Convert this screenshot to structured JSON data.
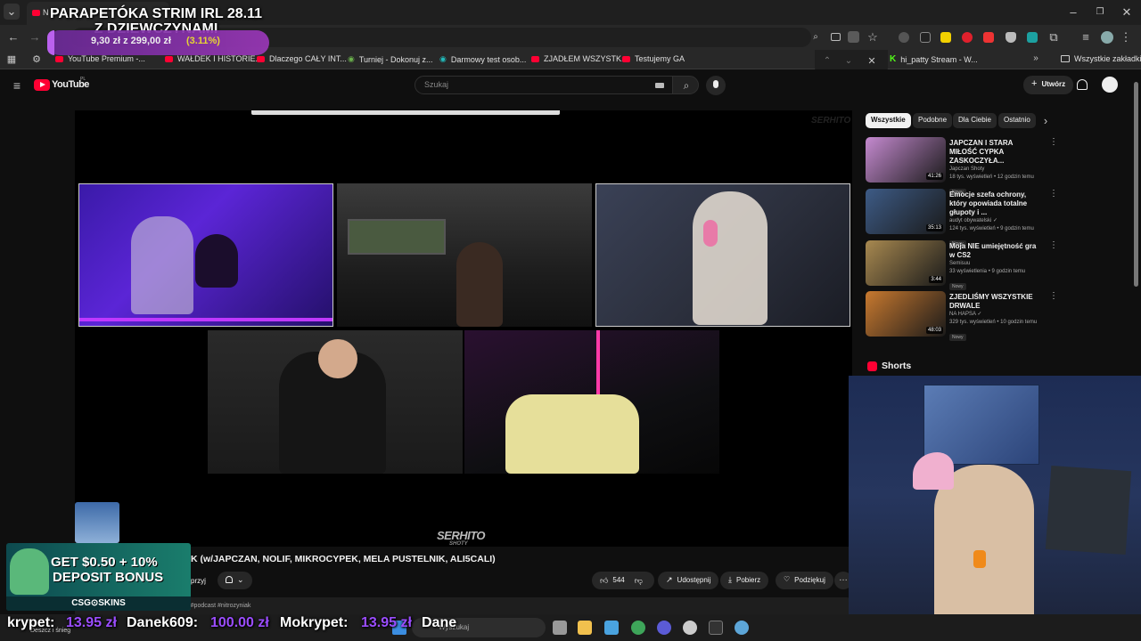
{
  "overlay": {
    "stream_title": "PARAPETÓKA STRIM IRL 28.11 Z DZIEWCZYNAMI",
    "goal_text": "9,30 zł z 299,00 zł",
    "goal_percent": "(3.11%)",
    "goal_progress": 0.0311,
    "ticker": [
      {
        "name": "krypet:",
        "amount": "13.95 zł"
      },
      {
        "name": "Danek609:",
        "amount": "100.00 zł"
      },
      {
        "name": "Mokrypet:",
        "amount": "13.95 zł"
      },
      {
        "name": "Dane",
        "amount": ""
      }
    ],
    "promo": {
      "line1": "GET $0.50 + 10%",
      "line2": "DEPOSIT BONUS",
      "brand": "CSG⊙SKINS"
    }
  },
  "browser": {
    "tab_title": "N",
    "bookmarks": [
      {
        "label": "YouTube Premium -..."
      },
      {
        "label": "WAŁDEK I HISTORIE..."
      },
      {
        "label": "Dlaczego CAŁY INT..."
      },
      {
        "label": "Turniej - Dokonuj z..."
      },
      {
        "label": "Darmowy test osob..."
      },
      {
        "label": "ZJADŁEM WSZYSTK..."
      },
      {
        "label": "Testujemy GA"
      }
    ],
    "bookmark_right": "hi_patty Stream - W...",
    "all_bookmarks": "Wszystkie zakładki"
  },
  "youtube": {
    "logo": "YouTube",
    "country": "PL",
    "search_placeholder": "Szukaj",
    "create_label": "Utwórz",
    "player_watermark": "SERHITO",
    "player_watermark_sub": "SHOTY",
    "video_title": "K (w/JAPCZAN, NOLIF, MIKROCYPEK, MELA PUSTELNIK, ALI5CALI)",
    "subscribe_partial": "przyj",
    "likes": "544",
    "share_label": "Udostępnij",
    "download_label": "Pobierz",
    "thanks_label": "Podziękuj",
    "hashtags": "itro #podcast #nitrozyniak",
    "chips": [
      "Wszystkie",
      "Podobne",
      "Dla Ciebie",
      "Ostatnio"
    ],
    "shorts_label": "Shorts",
    "recommendations": [
      {
        "title": "JAPCZAN I STARA MIŁOŚĆ CYPKA ZASKOCZYŁA...",
        "channel": "Japczan Shoty",
        "meta": "18 tys. wyświetleń • 12 godzin temu",
        "badge": "Nowy",
        "duration": "41:26",
        "color": "#c58ad0"
      },
      {
        "title": "Emocje szefa ochrony, który opowiada totalne głupoty i ...",
        "channel": "audyt obywatelski ✓",
        "meta": "124 tys. wyświetleń • 9 godzin temu",
        "badge": "Nowy",
        "duration": "35:13",
        "color": "#3d5b86"
      },
      {
        "title": "Moja NIE umiejętność gra w CS2",
        "channel": "Semisuu",
        "meta": "33 wyświetlenia • 9 godzin temu",
        "badge": "Nowy",
        "duration": "3:44",
        "color": "#a88950"
      },
      {
        "title": "ZJEDLIŚMY WSZYSTKIE DRWALE",
        "channel": "NA HAPSA ✓",
        "meta": "329 tys. wyświetleń • 10 godzin temu",
        "badge": "Nowy",
        "duration": "48:03",
        "color": "#c8792f"
      }
    ]
  },
  "taskbar": {
    "weather": "Deszcz i śnieg",
    "search_placeholder": "Wyszukaj"
  }
}
